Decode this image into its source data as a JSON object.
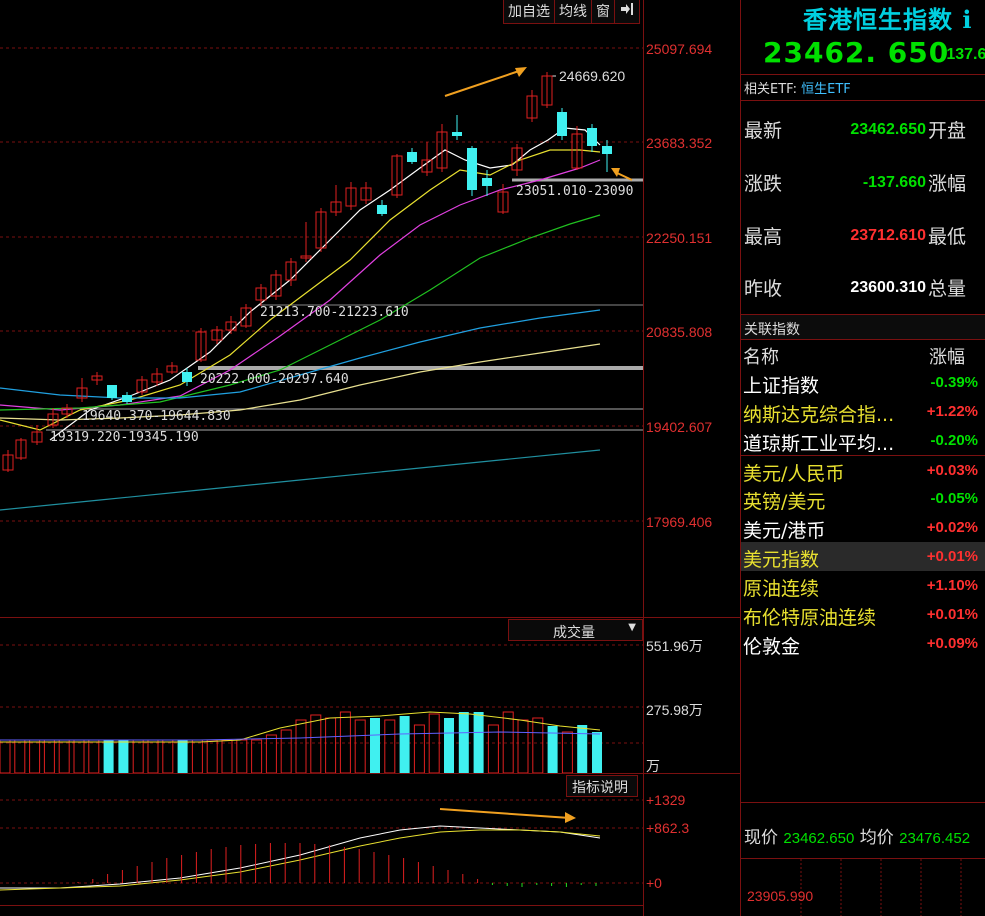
{
  "toolbar": {
    "add_watch": "加自选",
    "ma_line": "均线",
    "window": "窗",
    "exit_icon": "exit-arrow-icon"
  },
  "price_axis": [
    "25097.694",
    "23683.352",
    "22250.151",
    "20835.808",
    "19402.607",
    "17969.406"
  ],
  "volume_axis": [
    "551.96万",
    "275.98万",
    "万"
  ],
  "indicator_axis": [
    "+1329",
    "+862.3",
    "+0"
  ],
  "annotations": {
    "high_mark": "24669.620",
    "range_top": "23051.010-23090",
    "range_2": "21213.700-21223.610",
    "range_3": "20222.000-20297.640",
    "range_4": "19640.370-19644.830",
    "range_5": "19319.220-19345.190"
  },
  "volume_selector": "成交量",
  "indicator_button": "指标说明",
  "quote": {
    "title": "香港恒生指数 i",
    "price": "23462. 650",
    "change_short": "-137.6",
    "etf_label": "相关ETF:",
    "etf_link": "恒生ETF",
    "rows": [
      {
        "label": "最新",
        "value": "23462.650",
        "right_label": "开盘",
        "color": "green"
      },
      {
        "label": "涨跌",
        "value": "-137.660",
        "right_label": "涨幅",
        "color": "green"
      },
      {
        "label": "最高",
        "value": "23712.610",
        "right_label": "最低",
        "color": "red"
      },
      {
        "label": "昨收",
        "value": "23600.310",
        "right_label": "总量",
        "color": "white"
      }
    ]
  },
  "related": {
    "header": "关联指数",
    "col_name": "名称",
    "col_change": "涨幅",
    "items": [
      {
        "name": "上证指数",
        "change": "-0.39%",
        "name_color": "white",
        "color": "green"
      },
      {
        "name": "纳斯达克综合指...",
        "change": "+1.22%",
        "name_color": "yellow",
        "color": "red"
      },
      {
        "name": "道琼斯工业平均...",
        "change": "-0.20%",
        "name_color": "white",
        "color": "green"
      },
      {
        "name": "美元/人民币",
        "change": "+0.03%",
        "name_color": "yellow",
        "color": "red"
      },
      {
        "name": "英镑/美元",
        "change": "-0.05%",
        "name_color": "yellow",
        "color": "green"
      },
      {
        "name": "美元/港币",
        "change": "+0.02%",
        "name_color": "white",
        "color": "red"
      },
      {
        "name": "美元指数",
        "change": "+0.01%",
        "name_color": "yellow",
        "color": "red",
        "selected": true
      },
      {
        "name": "原油连续",
        "change": "+1.10%",
        "name_color": "yellow",
        "color": "red"
      },
      {
        "name": "布伦特原油连续",
        "change": "+0.01%",
        "name_color": "yellow",
        "color": "red"
      },
      {
        "name": "伦敦金",
        "change": "+0.09%",
        "name_color": "white",
        "color": "red"
      }
    ]
  },
  "intraday": {
    "now_label": "现价",
    "now_value": "23462.650",
    "avg_label": "均价",
    "avg_value": "23476.452",
    "axis_value": "23905.990"
  },
  "colors": {
    "grid": "#7a1010",
    "up": "#e02020",
    "down": "#40f0f0",
    "ma5": "#ffffff",
    "ma10": "#e8e030",
    "ma20": "#e040e0",
    "ma30": "#20c020",
    "ma60": "#20a0e0",
    "ma120": "#e8e090",
    "ma250": "#2090a0"
  }
}
